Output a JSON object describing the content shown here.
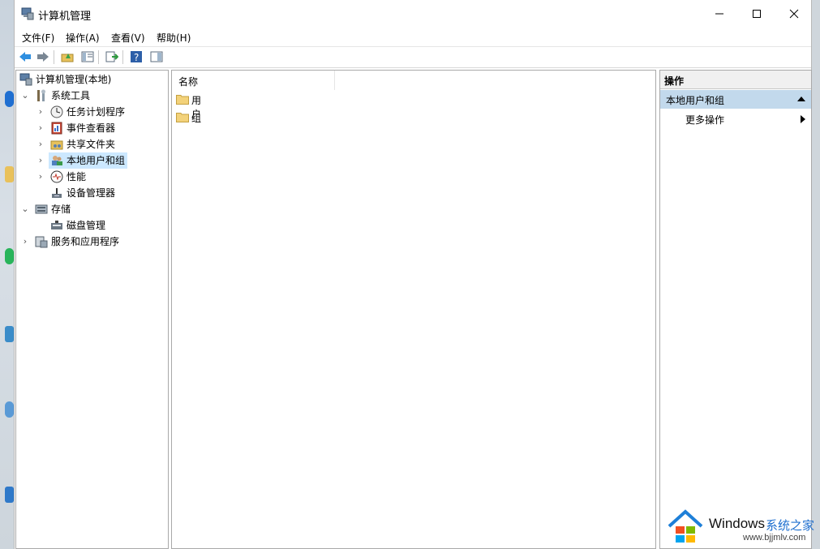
{
  "window": {
    "title": "计算机管理",
    "controls": {
      "minimize": "minimize",
      "maximize": "maximize",
      "close": "close"
    }
  },
  "menu": [
    "文件(F)",
    "操作(A)",
    "查看(V)",
    "帮助(H)"
  ],
  "toolbar": {
    "buttons": [
      "back-icon",
      "forward-icon",
      "up-folder-icon",
      "show-hide-tree-icon",
      "export-list-icon",
      "help-icon",
      "properties-pane-icon"
    ]
  },
  "tree": {
    "root": "计算机管理(本地)",
    "system_tools": "系统工具",
    "task_scheduler": "任务计划程序",
    "event_viewer": "事件查看器",
    "shared_folders": "共享文件夹",
    "local_users_groups": "本地用户和组",
    "performance": "性能",
    "device_manager": "设备管理器",
    "storage": "存储",
    "disk_management": "磁盘管理",
    "services_apps": "服务和应用程序"
  },
  "list": {
    "column_name": "名称",
    "items": [
      "用户",
      "组"
    ]
  },
  "actions": {
    "header": "操作",
    "group": "本地用户和组",
    "more": "更多操作"
  },
  "watermark": {
    "brand": "Windows",
    "site_name": "系统之家",
    "url": "www.bjjmlv.com"
  },
  "colors": {
    "selection": "#cce8ff",
    "action_group": "#c2d9ec",
    "folder": "#f3d27a"
  }
}
